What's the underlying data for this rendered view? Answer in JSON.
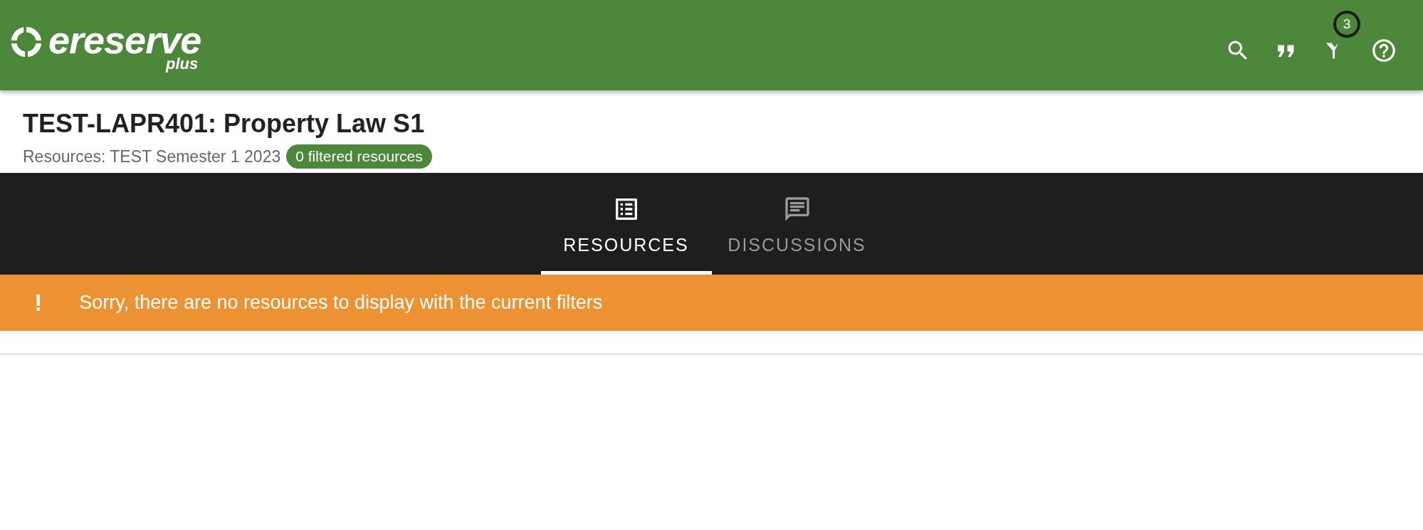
{
  "logo": {
    "name": "ereserve",
    "suffix": "plus"
  },
  "toolbar": {
    "filter_badge": "3"
  },
  "course": {
    "title": "TEST-LAPR401: Property Law S1",
    "subtitle": "Resources: TEST Semester 1 2023",
    "filter_chip": "0 filtered resources"
  },
  "tabs": [
    {
      "label": "RESOURCES",
      "kind": "list",
      "selected": true
    },
    {
      "label": "DISCUSSIONS",
      "kind": "chat",
      "selected": false
    }
  ],
  "alert": {
    "icon": "!",
    "message": "Sorry, there are no resources to display with the current filters"
  }
}
